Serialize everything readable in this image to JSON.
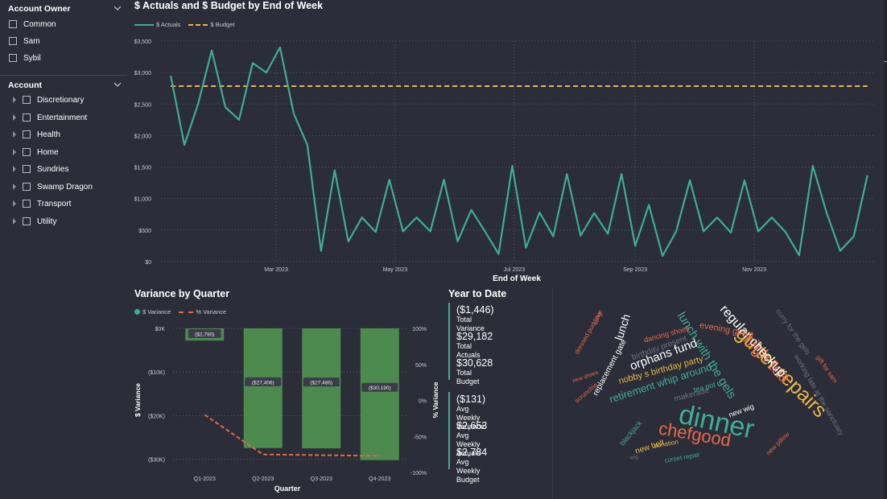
{
  "slicers": {
    "owner": {
      "title": "Account Owner",
      "items": [
        "Common",
        "Sam",
        "Sybil"
      ]
    },
    "account": {
      "title": "Account",
      "items": [
        "Discretionary",
        "Entertainment",
        "Health",
        "Home",
        "Sundries",
        "Swamp Dragon",
        "Transport",
        "Utility"
      ]
    }
  },
  "line_chart": {
    "title": "$ Actuals and $ Budget by End of Week",
    "legend": [
      "$ Actuals",
      "$ Budget"
    ],
    "xlabel": "End of Week",
    "y_ticks": [
      "$3,500",
      "$3,000",
      "$2,500",
      "$2,000",
      "$1,500",
      "$1,000",
      "$500",
      "$0"
    ],
    "x_ticks": [
      "Mar 2023",
      "May 2023",
      "Jul 2023",
      "Sep 2023",
      "Nov 2023"
    ]
  },
  "variance_chart": {
    "title": "Variance by Quarter",
    "legend": [
      "$ Variance",
      "% Variance"
    ],
    "xlabel": "Quarter",
    "ylabel_left": "$ Variance",
    "ylabel_right": "% Variance",
    "left_ticks": [
      "$0K",
      "($10K)",
      "($20K)",
      "($30K)"
    ],
    "right_ticks": [
      "100%",
      "50%",
      "0%",
      "-50%",
      "-100%"
    ]
  },
  "ytd": {
    "title": "Year to Date",
    "group1": [
      {
        "value": "($1,446)",
        "label": "Total Variance"
      },
      {
        "value": "$29,182",
        "label": "Total Actuals"
      },
      {
        "value": "$30,628",
        "label": "Total Budget"
      }
    ],
    "group2": [
      {
        "value": "($131)",
        "label": "Avg Weekly Variance"
      },
      {
        "value": "$2,653",
        "label": "Avg Weekly Actuals"
      },
      {
        "value": "$2,784",
        "label": "Avg Weekly Budget"
      }
    ]
  },
  "word_cloud": [
    "dinner",
    "gutter repairs",
    "chefgood",
    "high tea",
    "regular checkup",
    "lunch with the gels",
    "orphans fund",
    "retirement whip around",
    "lunch",
    "evening gown",
    "nobby s birthday party",
    "curry for the gels",
    "working late at the sanctuary",
    "replacement gate",
    "birthday present",
    "dancing shoes",
    "new belt",
    "blackjack",
    "donation",
    "corset repair",
    "new pillow",
    "new wig",
    "makerade",
    "tea pot",
    "gift for sam",
    "dressed pudding",
    "coffee",
    "scrunchie",
    "new shoes",
    "wig"
  ],
  "colors": {
    "actuals": "#3dae94",
    "budget": "#e8b844",
    "bars": "#4c8a4e",
    "pct": "#e8694a",
    "background": "#2b2d38"
  },
  "chart_data": [
    {
      "type": "line",
      "title": "$ Actuals and $ Budget by End of Week",
      "xlabel": "End of Week",
      "ylabel": "",
      "ylim": [
        0,
        3500
      ],
      "x": [
        "2023-01-06",
        "2023-01-13",
        "2023-01-20",
        "2023-01-27",
        "2023-02-03",
        "2023-02-10",
        "2023-02-17",
        "2023-02-24",
        "2023-03-03",
        "2023-03-10",
        "2023-03-17",
        "2023-03-24",
        "2023-03-31",
        "2023-04-07",
        "2023-04-14",
        "2023-04-21",
        "2023-04-28",
        "2023-05-05",
        "2023-05-12",
        "2023-05-19",
        "2023-05-26",
        "2023-06-02",
        "2023-06-09",
        "2023-06-16",
        "2023-06-23",
        "2023-06-30",
        "2023-07-07",
        "2023-07-14",
        "2023-07-21",
        "2023-07-28",
        "2023-08-04",
        "2023-08-11",
        "2023-08-18",
        "2023-08-25",
        "2023-09-01",
        "2023-09-08",
        "2023-09-15",
        "2023-09-22",
        "2023-09-29",
        "2023-10-06",
        "2023-10-13",
        "2023-10-20",
        "2023-10-27",
        "2023-11-03",
        "2023-11-10",
        "2023-11-17",
        "2023-11-24",
        "2023-12-01",
        "2023-12-08",
        "2023-12-15",
        "2023-12-22",
        "2023-12-29"
      ],
      "series": [
        {
          "name": "$ Actuals",
          "values": [
            2950,
            1850,
            2500,
            3350,
            2450,
            2250,
            3150,
            3000,
            3400,
            2350,
            1850,
            170,
            1450,
            320,
            700,
            470,
            1300,
            480,
            700,
            480,
            1300,
            320,
            820,
            480,
            120,
            1520,
            220,
            780,
            400,
            1390,
            410,
            770,
            440,
            1390,
            250,
            900,
            90,
            480,
            1290,
            480,
            700,
            460,
            1290,
            480,
            700,
            470,
            100,
            1520,
            780,
            170,
            400,
            1370
          ]
        },
        {
          "name": "$ Budget",
          "values": [
            2784,
            2784,
            2784,
            2784,
            2784,
            2784,
            2784,
            2784,
            2784,
            2784,
            2784,
            2784,
            2784,
            2784,
            2784,
            2784,
            2784,
            2784,
            2784,
            2784,
            2784,
            2784,
            2784,
            2784,
            2784,
            2784,
            2784,
            2784,
            2784,
            2784,
            2784,
            2784,
            2784,
            2784,
            2784,
            2784,
            2784,
            2784,
            2784,
            2784,
            2784,
            2784,
            2784,
            2784,
            2784,
            2784,
            2784,
            2784,
            2784,
            2784,
            2784,
            2784
          ]
        }
      ]
    },
    {
      "type": "bar",
      "title": "Variance by Quarter",
      "xlabel": "Quarter",
      "ylabel": "$ Variance",
      "categories": [
        "Q1-2023",
        "Q2-2023",
        "Q3-2023",
        "Q4-2023"
      ],
      "ylim": [
        -33000,
        0
      ],
      "y2lim": [
        -100,
        100
      ],
      "series": [
        {
          "name": "$ Variance",
          "values": [
            -2790,
            -27406,
            -27486,
            -30190
          ],
          "labels": [
            "($2,790)",
            "($27,406)",
            "($27,486)",
            "($30,190)"
          ]
        },
        {
          "name": "% Variance",
          "values": [
            -20,
            -75,
            -76,
            -77
          ]
        }
      ]
    }
  ]
}
